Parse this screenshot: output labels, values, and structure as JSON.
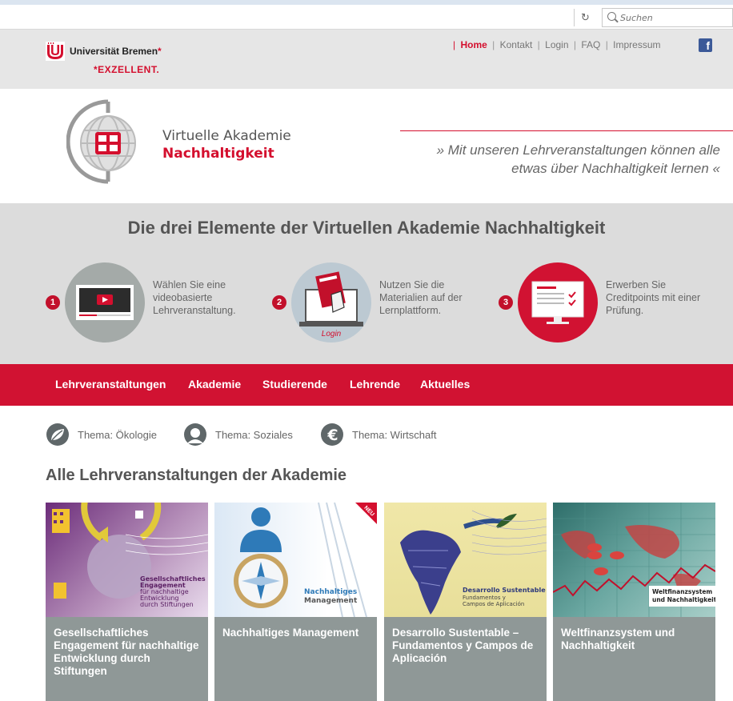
{
  "browser": {
    "reload_icon": "reload-icon",
    "search_placeholder": "Suchen"
  },
  "university": {
    "name": "Universität Bremen",
    "star": "*",
    "excellent": "*EXZELLENT."
  },
  "top_nav": {
    "items": [
      "Home",
      "Kontakt",
      "Login",
      "FAQ",
      "Impressum"
    ],
    "active": "Home"
  },
  "logo": {
    "line1": "Virtuelle Akademie",
    "line2": "Nachhaltigkeit"
  },
  "tagline": {
    "line1": "» Mit unseren Lehrveranstaltungen können alle",
    "line2": "etwas über Nachhaltigkeit lernen «"
  },
  "elements": {
    "title": "Die drei Elemente der Virtuellen Akademie Nachhaltigkeit",
    "steps": [
      {
        "num": "1",
        "text": "Wählen Sie eine videobasierte Lehrveranstaltung.",
        "icon": "video-player-icon"
      },
      {
        "num": "2",
        "text": "Nutzen Sie die Materialien auf der Lernplattform.",
        "icon": "login-laptop-icon",
        "icon_label": "Login"
      },
      {
        "num": "3",
        "text": "Erwerben Sie Creditpoints mit einer Prüfung.",
        "icon": "exam-monitor-icon"
      }
    ]
  },
  "main_nav": {
    "items": [
      "Lehrveranstaltungen",
      "Akademie",
      "Studierende",
      "Lehrende",
      "Aktuelles"
    ]
  },
  "themes": [
    {
      "label": "Thema: Ökologie",
      "icon": "leaf-icon"
    },
    {
      "label": "Thema: Soziales",
      "icon": "person-icon"
    },
    {
      "label": "Thema: Wirtschaft",
      "icon": "euro-icon"
    }
  ],
  "section_title": "Alle Lehrveranstaltungen der Akademie",
  "courses": [
    {
      "title": "Gesellschaftliches Engagement für nachhaltige Entwicklung durch Stiftungen",
      "img_caption": [
        "Gesellschaftliches",
        "Engagement",
        "für nachhaltige",
        "Entwicklung",
        "durch Stiftungen"
      ]
    },
    {
      "title": "Nachhaltiges Management",
      "img_caption": [
        "Nachhaltiges",
        "Management"
      ],
      "badge": "NEU"
    },
    {
      "title": "Desarrollo Sustentable – Fundamentos y Campos de Aplicación",
      "img_caption": [
        "Desarrollo Sustentable",
        "Fundamentos y",
        "Campos de Aplicación"
      ]
    },
    {
      "title": "Weltfinanzsystem und Nachhaltigkeit",
      "img_caption": [
        "Weltfinanzsystem",
        "und Nachhaltigkeit"
      ]
    }
  ],
  "colors": {
    "brand_red": "#d11232",
    "header_gray": "#e6e6e6",
    "section_gray": "#dcdcdc",
    "card_caption": "#8f9897"
  }
}
